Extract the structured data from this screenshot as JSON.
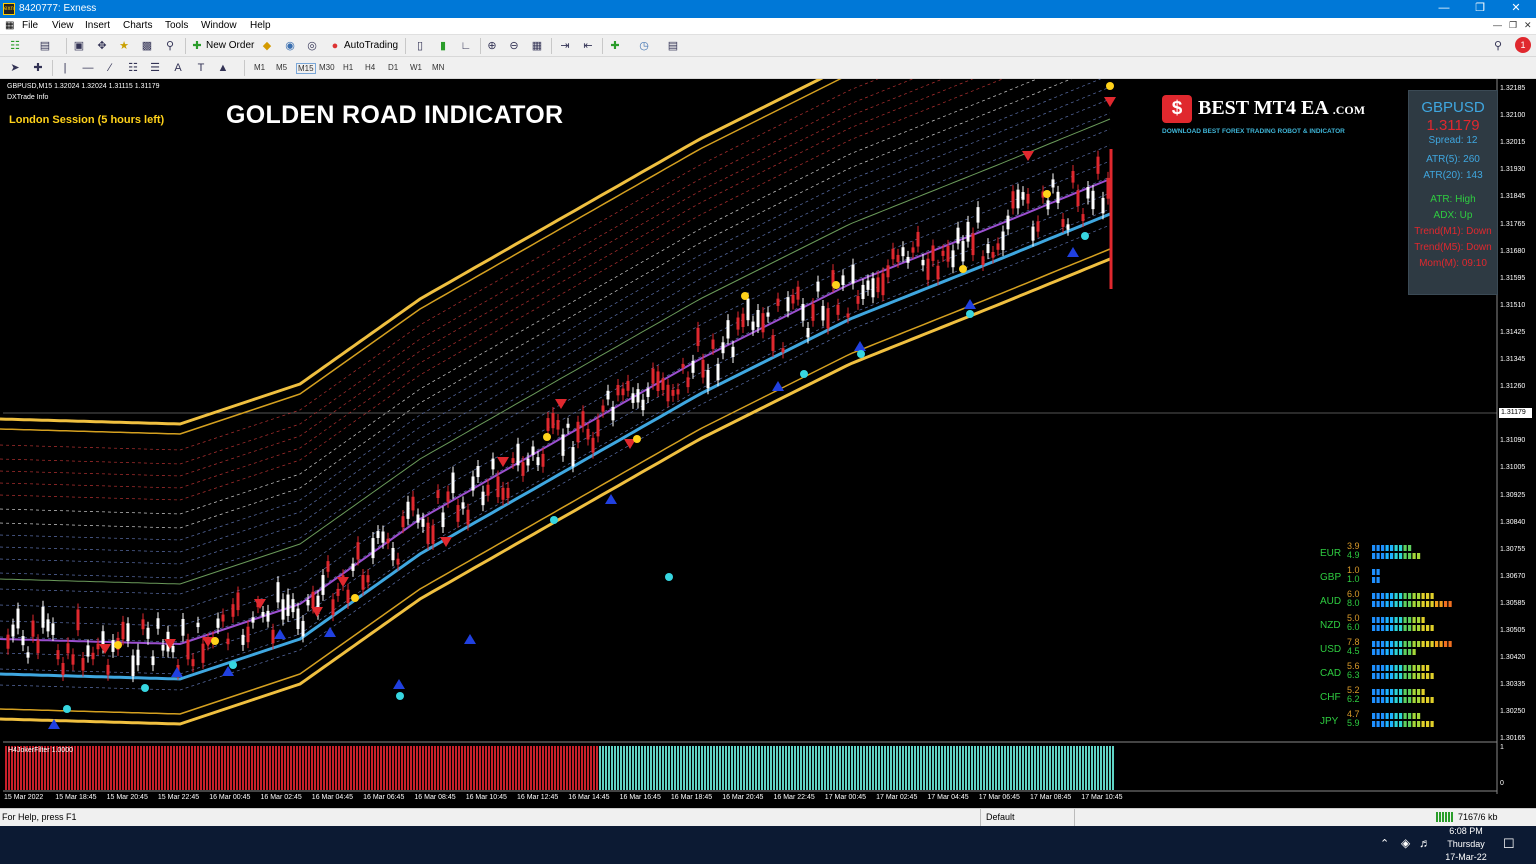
{
  "window": {
    "title": "8420777: Exness",
    "icon_text": "exn"
  },
  "menu": [
    "File",
    "View",
    "Insert",
    "Charts",
    "Tools",
    "Window",
    "Help"
  ],
  "toolbar": {
    "new_order": "New Order",
    "autotrading": "AutoTrading",
    "timeframes": [
      "M1",
      "M5",
      "M15",
      "M30",
      "H1",
      "H4",
      "D1",
      "W1",
      "MN"
    ],
    "notifications": "1"
  },
  "chart": {
    "symbol_line": "GBPUSD,M15  1.32024 1.32024 1.31115 1.31179",
    "info_label": "DXTrade Info",
    "session": "London Session (5 hours left)",
    "headline": "GOLDEN ROAD INDICATOR",
    "current_price": "1.31179",
    "sub_window_label": "H4JokerFilter 1.0000",
    "sub_axis": [
      "1",
      "0"
    ]
  },
  "logo": {
    "text": "BEST MT4 EA",
    "suffix": ".COM",
    "tagline": "DOWNLOAD BEST FOREX TRADING ROBOT & INDICATOR",
    "mark": "$"
  },
  "info_panel": {
    "symbol": "GBPUSD",
    "price": "1.31179",
    "spread": "Spread: 12",
    "atr5": "ATR(5): 260",
    "atr20": "ATR(20): 143",
    "atr_state": "ATR: High",
    "adx": "ADX: Up",
    "trend1": "Trend(M1): Down",
    "trend2": "Trend(M5): Down",
    "momentum": "Mom(M): 09:10"
  },
  "strength": [
    {
      "cur": "EUR",
      "a": "3.9",
      "b": "4.9"
    },
    {
      "cur": "GBP",
      "a": "1.0",
      "b": "1.0"
    },
    {
      "cur": "AUD",
      "a": "6.0",
      "b": "8.0"
    },
    {
      "cur": "NZD",
      "a": "5.0",
      "b": "6.0"
    },
    {
      "cur": "USD",
      "a": "7.8",
      "b": "4.5"
    },
    {
      "cur": "CAD",
      "a": "5.6",
      "b": "6.3"
    },
    {
      "cur": "CHF",
      "a": "5.2",
      "b": "6.2"
    },
    {
      "cur": "JPY",
      "a": "4.7",
      "b": "5.9"
    }
  ],
  "y_axis": [
    "1.32185",
    "1.32100",
    "1.32015",
    "1.31930",
    "1.31845",
    "1.31765",
    "1.31680",
    "1.31595",
    "1.31510",
    "1.31425",
    "1.31345",
    "1.31260",
    "1.31090",
    "1.31005",
    "1.30925",
    "1.30840",
    "1.30755",
    "1.30670",
    "1.30585",
    "1.30505",
    "1.30420",
    "1.30335",
    "1.30250",
    "1.30165"
  ],
  "x_axis": [
    "15 Mar 2022",
    "15 Mar 18:45",
    "15 Mar 20:45",
    "15 Mar 22:45",
    "16 Mar 00:45",
    "16 Mar 02:45",
    "16 Mar 04:45",
    "16 Mar 06:45",
    "16 Mar 08:45",
    "16 Mar 10:45",
    "16 Mar 12:45",
    "16 Mar 14:45",
    "16 Mar 16:45",
    "16 Mar 18:45",
    "16 Mar 20:45",
    "16 Mar 22:45",
    "17 Mar 00:45",
    "17 Mar 02:45",
    "17 Mar 04:45",
    "17 Mar 06:45",
    "17 Mar 08:45",
    "17 Mar 10:45"
  ],
  "status": {
    "help": "For Help, press F1",
    "profile": "Default",
    "traffic": "7167/6 kb"
  },
  "taskbar": {
    "time": "6:08 PM",
    "day": "Thursday",
    "date": "17-Mar-22"
  }
}
